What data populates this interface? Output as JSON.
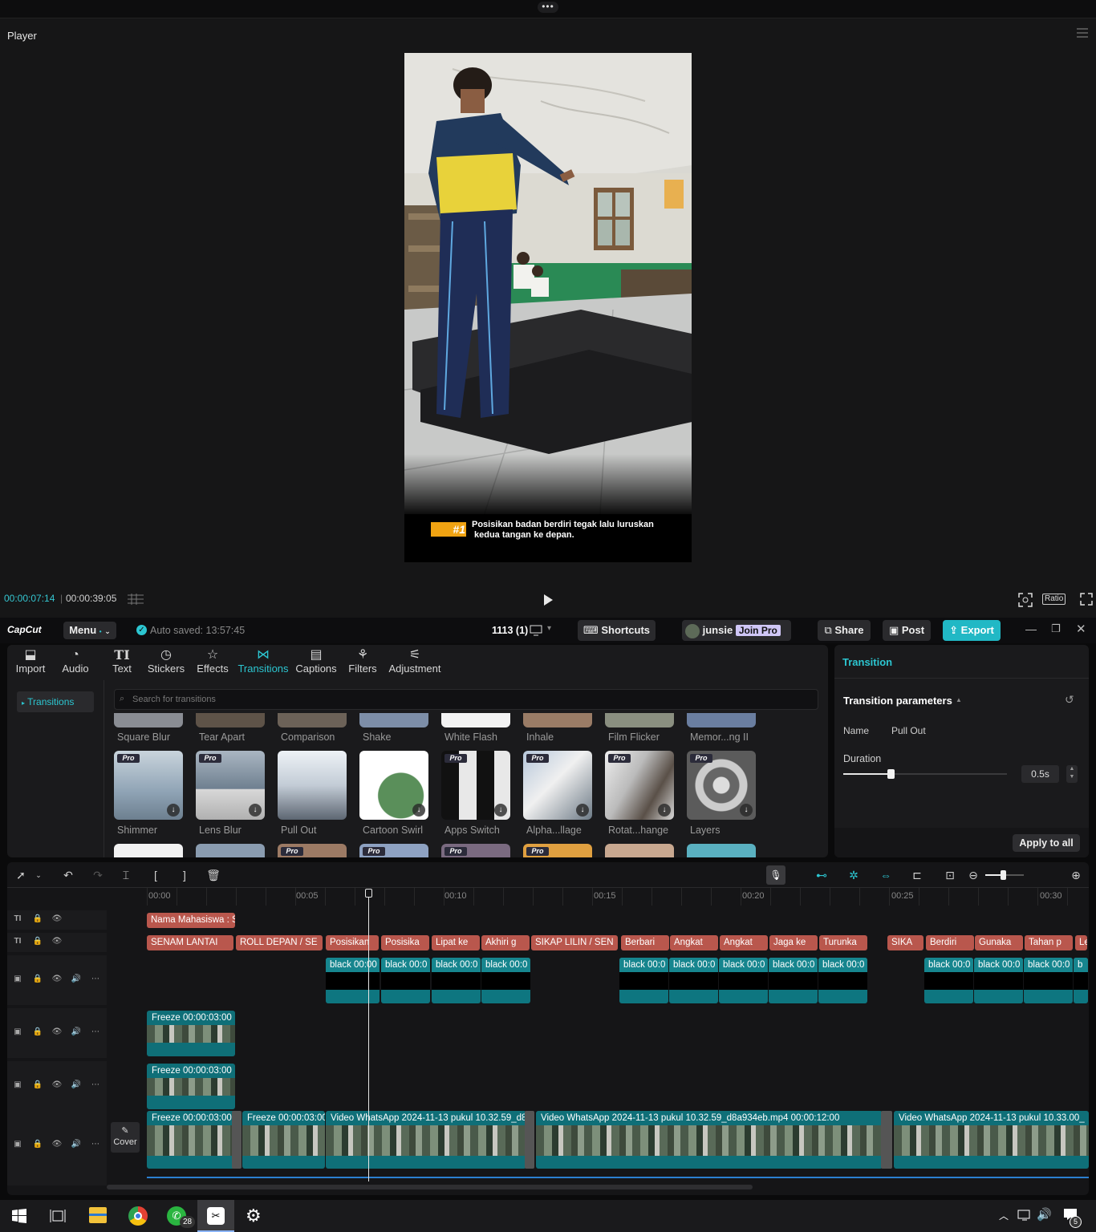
{
  "player": {
    "title": "Player",
    "time_current": "00:00:07:14",
    "time_total": "00:00:39:05",
    "ratio_label": "Ratio",
    "caption_badge": "#1",
    "caption_line1": "Posisikan badan berdiri tegak lalu luruskan",
    "caption_line2": "kedua tangan ke depan."
  },
  "app": {
    "logo": "CapCut",
    "menu_label": "Menu",
    "autosave": "Auto saved: 13:57:45",
    "project_name": "1113 (1)",
    "shortcuts": "Shortcuts",
    "user": "junsie",
    "join_pro": "Join Pro",
    "share": "Share",
    "post": "Post",
    "export": "Export"
  },
  "tabs": [
    {
      "label": "Import",
      "icon": "import-icon"
    },
    {
      "label": "Audio",
      "icon": "audio-icon"
    },
    {
      "label": "Text",
      "icon": "text-icon"
    },
    {
      "label": "Stickers",
      "icon": "stickers-icon"
    },
    {
      "label": "Effects",
      "icon": "effects-icon"
    },
    {
      "label": "Transitions",
      "icon": "transitions-icon"
    },
    {
      "label": "Captions",
      "icon": "captions-icon"
    },
    {
      "label": "Filters",
      "icon": "filters-icon"
    },
    {
      "label": "Adjustment",
      "icon": "adjustment-icon"
    }
  ],
  "sidebar": {
    "item": "Transitions"
  },
  "search": {
    "placeholder": "Search for transitions"
  },
  "transitions_row1": [
    "Square Blur",
    "Tear Apart",
    "Comparison",
    "Shake",
    "White Flash",
    "Inhale",
    "Film Flicker",
    "Memor...ng II"
  ],
  "transitions_row2": [
    {
      "label": "Shimmer",
      "pro": true
    },
    {
      "label": "Lens Blur",
      "pro": true
    },
    {
      "label": "Pull Out",
      "pro": false
    },
    {
      "label": "Cartoon Swirl",
      "pro": false
    },
    {
      "label": "Apps Switch",
      "pro": true
    },
    {
      "label": "Alpha...llage",
      "pro": true
    },
    {
      "label": "Rotat...hange",
      "pro": true
    },
    {
      "label": "Layers",
      "pro": true
    }
  ],
  "pro_badge": "Pro",
  "props": {
    "header": "Transition",
    "section": "Transition parameters",
    "name_label": "Name",
    "name_value": "Pull Out",
    "duration_label": "Duration",
    "duration_value": "0.5s",
    "duration_fraction": 0.29,
    "apply_all": "Apply to all"
  },
  "timeline": {
    "ruler": [
      "00:00",
      "00:05",
      "00:10",
      "00:15",
      "00:20",
      "00:25",
      "00:30"
    ],
    "playhead_time": "00:00:07:14",
    "text_track1": [
      "Nama Mahasiswa : S"
    ],
    "text_track2": [
      "SENAM LANTAI",
      "ROLL DEPAN / SE",
      "Posisikan",
      "Posisika",
      "Lipat ke",
      "Akhiri g",
      "SIKAP LILIN / SEN",
      "Berbari",
      "Angkat",
      "Angkat",
      "Jaga ke",
      "Turunka",
      "SIKA",
      "Berdiri",
      "Gunaka",
      "Tahan p",
      "Le"
    ],
    "black_clips": [
      "black 00:00",
      "black 00:0",
      "black 00:0",
      "black 00:0",
      "black 00:0",
      "black 00:0",
      "black 00:0",
      "black 00:0",
      "black 00:0",
      "black 00:0",
      "black 00:0",
      "black 00:0",
      "b"
    ],
    "freeze1": "Freeze  00:00:03:00",
    "freeze2": "Freeze  00:00:03:00",
    "main_clips": [
      "Freeze  00:00:03:00",
      "Freeze  00:00:03:00",
      "Video WhatsApp 2024-11-13 pukul 10.32.59_d8",
      "Video WhatsApp 2024-11-13 pukul 10.32.59_d8a934eb.mp4   00:00:12:00",
      "Video WhatsApp 2024-11-13 pukul 10.33.00_"
    ],
    "cover_label": "Cover"
  },
  "taskbar": {
    "whatsapp_badge": "28",
    "notif_badge": "5"
  }
}
